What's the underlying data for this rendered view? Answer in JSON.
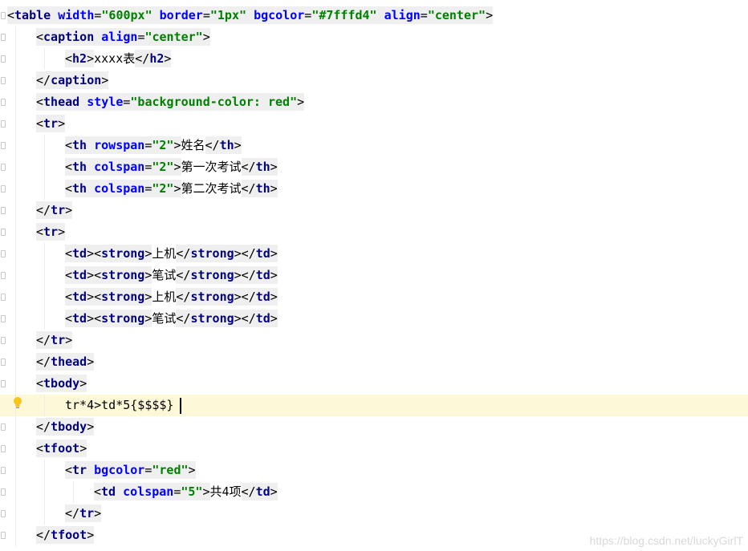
{
  "lines": [
    {
      "indent": 0,
      "tokens": [
        [
          "p",
          "<"
        ],
        [
          "t",
          "table"
        ],
        [
          "s",
          " "
        ],
        [
          "a",
          "width"
        ],
        [
          "p",
          "="
        ],
        [
          "v",
          "\"600px\""
        ],
        [
          "s",
          " "
        ],
        [
          "a",
          "border"
        ],
        [
          "p",
          "="
        ],
        [
          "v",
          "\"1px\""
        ],
        [
          "s",
          " "
        ],
        [
          "a",
          "bgcolor"
        ],
        [
          "p",
          "="
        ],
        [
          "v",
          "\"#7fffd4\""
        ],
        [
          "s",
          " "
        ],
        [
          "a",
          "align"
        ],
        [
          "p",
          "="
        ],
        [
          "v",
          "\"center\""
        ],
        [
          "p",
          ">"
        ]
      ]
    },
    {
      "indent": 1,
      "tokens": [
        [
          "p",
          "<"
        ],
        [
          "t",
          "caption"
        ],
        [
          "s",
          " "
        ],
        [
          "a",
          "align"
        ],
        [
          "p",
          "="
        ],
        [
          "v",
          "\"center\""
        ],
        [
          "p",
          ">"
        ]
      ]
    },
    {
      "indent": 2,
      "tokens": [
        [
          "p",
          "<"
        ],
        [
          "t",
          "h2"
        ],
        [
          "p",
          ">"
        ],
        [
          "x",
          "xxxx表"
        ],
        [
          "p",
          "</"
        ],
        [
          "t",
          "h2"
        ],
        [
          "p",
          ">"
        ]
      ]
    },
    {
      "indent": 1,
      "tokens": [
        [
          "p",
          "</"
        ],
        [
          "t",
          "caption"
        ],
        [
          "p",
          ">"
        ]
      ]
    },
    {
      "indent": 1,
      "tokens": [
        [
          "p",
          "<"
        ],
        [
          "t",
          "thead"
        ],
        [
          "s",
          " "
        ],
        [
          "a",
          "style"
        ],
        [
          "p",
          "="
        ],
        [
          "v",
          "\"background-color: red\""
        ],
        [
          "p",
          ">"
        ]
      ]
    },
    {
      "indent": 1,
      "tokens": [
        [
          "p",
          "<"
        ],
        [
          "t",
          "tr"
        ],
        [
          "p",
          ">"
        ]
      ]
    },
    {
      "indent": 2,
      "tokens": [
        [
          "p",
          "<"
        ],
        [
          "t",
          "th"
        ],
        [
          "s",
          " "
        ],
        [
          "a",
          "rowspan"
        ],
        [
          "p",
          "="
        ],
        [
          "v",
          "\"2\""
        ],
        [
          "p",
          ">"
        ],
        [
          "x",
          "姓名"
        ],
        [
          "p",
          "</"
        ],
        [
          "t",
          "th"
        ],
        [
          "p",
          ">"
        ]
      ]
    },
    {
      "indent": 2,
      "tokens": [
        [
          "p",
          "<"
        ],
        [
          "t",
          "th"
        ],
        [
          "s",
          " "
        ],
        [
          "a",
          "colspan"
        ],
        [
          "p",
          "="
        ],
        [
          "v",
          "\"2\""
        ],
        [
          "p",
          ">"
        ],
        [
          "x",
          "第一次考试"
        ],
        [
          "p",
          "</"
        ],
        [
          "t",
          "th"
        ],
        [
          "p",
          ">"
        ]
      ]
    },
    {
      "indent": 2,
      "tokens": [
        [
          "p",
          "<"
        ],
        [
          "t",
          "th"
        ],
        [
          "s",
          " "
        ],
        [
          "a",
          "colspan"
        ],
        [
          "p",
          "="
        ],
        [
          "v",
          "\"2\""
        ],
        [
          "p",
          ">"
        ],
        [
          "x",
          "第二次考试"
        ],
        [
          "p",
          "</"
        ],
        [
          "t",
          "th"
        ],
        [
          "p",
          ">"
        ]
      ]
    },
    {
      "indent": 1,
      "tokens": [
        [
          "p",
          "</"
        ],
        [
          "t",
          "tr"
        ],
        [
          "p",
          ">"
        ]
      ]
    },
    {
      "indent": 1,
      "tokens": [
        [
          "p",
          "<"
        ],
        [
          "t",
          "tr"
        ],
        [
          "p",
          ">"
        ]
      ]
    },
    {
      "indent": 2,
      "tokens": [
        [
          "p",
          "<"
        ],
        [
          "t",
          "td"
        ],
        [
          "p",
          "><"
        ],
        [
          "t",
          "strong"
        ],
        [
          "p",
          ">"
        ],
        [
          "x",
          "上机"
        ],
        [
          "p",
          "</"
        ],
        [
          "t",
          "strong"
        ],
        [
          "p",
          "></"
        ],
        [
          "t",
          "td"
        ],
        [
          "p",
          ">"
        ]
      ]
    },
    {
      "indent": 2,
      "tokens": [
        [
          "p",
          "<"
        ],
        [
          "t",
          "td"
        ],
        [
          "p",
          "><"
        ],
        [
          "t",
          "strong"
        ],
        [
          "p",
          ">"
        ],
        [
          "x",
          "笔试"
        ],
        [
          "p",
          "</"
        ],
        [
          "t",
          "strong"
        ],
        [
          "p",
          "></"
        ],
        [
          "t",
          "td"
        ],
        [
          "p",
          ">"
        ]
      ]
    },
    {
      "indent": 2,
      "tokens": [
        [
          "p",
          "<"
        ],
        [
          "t",
          "td"
        ],
        [
          "p",
          "><"
        ],
        [
          "t",
          "strong"
        ],
        [
          "p",
          ">"
        ],
        [
          "x",
          "上机"
        ],
        [
          "p",
          "</"
        ],
        [
          "t",
          "strong"
        ],
        [
          "p",
          "></"
        ],
        [
          "t",
          "td"
        ],
        [
          "p",
          ">"
        ]
      ]
    },
    {
      "indent": 2,
      "tokens": [
        [
          "p",
          "<"
        ],
        [
          "t",
          "td"
        ],
        [
          "p",
          "><"
        ],
        [
          "t",
          "strong"
        ],
        [
          "p",
          ">"
        ],
        [
          "x",
          "笔试"
        ],
        [
          "p",
          "</"
        ],
        [
          "t",
          "strong"
        ],
        [
          "p",
          "></"
        ],
        [
          "t",
          "td"
        ],
        [
          "p",
          ">"
        ]
      ]
    },
    {
      "indent": 1,
      "tokens": [
        [
          "p",
          "</"
        ],
        [
          "t",
          "tr"
        ],
        [
          "p",
          ">"
        ]
      ]
    },
    {
      "indent": 1,
      "tokens": [
        [
          "p",
          "</"
        ],
        [
          "t",
          "thead"
        ],
        [
          "p",
          ">"
        ]
      ]
    },
    {
      "indent": 1,
      "tokens": [
        [
          "p",
          "<"
        ],
        [
          "t",
          "tbody"
        ],
        [
          "p",
          ">"
        ]
      ]
    },
    {
      "indent": 2,
      "current": true,
      "tokens": [
        [
          "x",
          "tr*4>td*5{$$$$}"
        ]
      ]
    },
    {
      "indent": 1,
      "tokens": [
        [
          "p",
          "</"
        ],
        [
          "t",
          "tbody"
        ],
        [
          "p",
          ">"
        ]
      ]
    },
    {
      "indent": 1,
      "tokens": [
        [
          "p",
          "<"
        ],
        [
          "t",
          "tfoot"
        ],
        [
          "p",
          ">"
        ]
      ]
    },
    {
      "indent": 2,
      "tokens": [
        [
          "p",
          "<"
        ],
        [
          "t",
          "tr"
        ],
        [
          "s",
          " "
        ],
        [
          "a",
          "bgcolor"
        ],
        [
          "p",
          "="
        ],
        [
          "v",
          "\"red\""
        ],
        [
          "p",
          ">"
        ]
      ]
    },
    {
      "indent": 3,
      "tokens": [
        [
          "p",
          "<"
        ],
        [
          "t",
          "td"
        ],
        [
          "s",
          " "
        ],
        [
          "a",
          "colspan"
        ],
        [
          "p",
          "="
        ],
        [
          "v",
          "\"5\""
        ],
        [
          "p",
          ">"
        ],
        [
          "x",
          "共4项"
        ],
        [
          "p",
          "</"
        ],
        [
          "t",
          "td"
        ],
        [
          "p",
          ">"
        ]
      ]
    },
    {
      "indent": 2,
      "tokens": [
        [
          "p",
          "</"
        ],
        [
          "t",
          "tr"
        ],
        [
          "p",
          ">"
        ]
      ]
    },
    {
      "indent": 1,
      "tokens": [
        [
          "p",
          "</"
        ],
        [
          "t",
          "tfoot"
        ],
        [
          "p",
          ">"
        ]
      ]
    }
  ],
  "watermark": "https://blog.csdn.net/luckyGirlT",
  "icons": {
    "intention": "lightbulb-icon"
  },
  "colors": {
    "current_line": "#fdf8d8",
    "tag": "#000080",
    "attr": "#0000ff",
    "string": "#008000"
  }
}
